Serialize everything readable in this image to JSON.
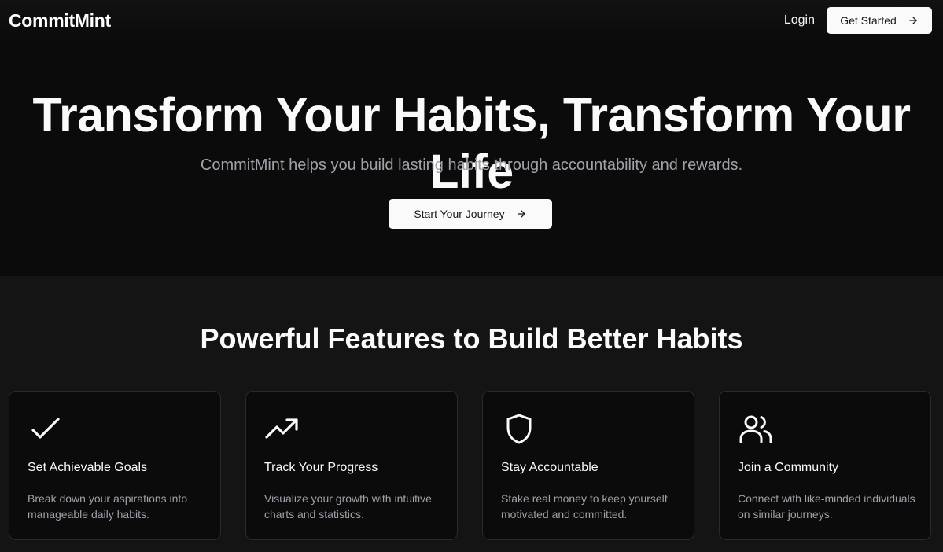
{
  "header": {
    "brand": "CommitMint",
    "login_label": "Login",
    "get_started_label": "Get Started"
  },
  "hero": {
    "title": "Transform Your Habits, Transform Your Life",
    "subtitle": "CommitMint helps you build lasting habits through accountability and rewards.",
    "cta_label": "Start Your Journey"
  },
  "features": {
    "title": "Powerful Features to Build Better Habits",
    "items": [
      {
        "icon": "check-icon",
        "title": "Set Achievable Goals",
        "description": "Break down your aspirations into manageable daily habits."
      },
      {
        "icon": "trending-up-icon",
        "title": "Track Your Progress",
        "description": "Visualize your growth with intuitive charts and statistics."
      },
      {
        "icon": "shield-icon",
        "title": "Stay Accountable",
        "description": "Stake real money to keep yourself motivated and committed."
      },
      {
        "icon": "users-icon",
        "title": "Join a Community",
        "description": "Connect with like-minded individuals on similar journeys."
      }
    ]
  },
  "colors": {
    "background": "#0b0b0b",
    "section_background": "#141414",
    "button_background": "#fafafa",
    "muted_text": "#a1a1aa"
  }
}
